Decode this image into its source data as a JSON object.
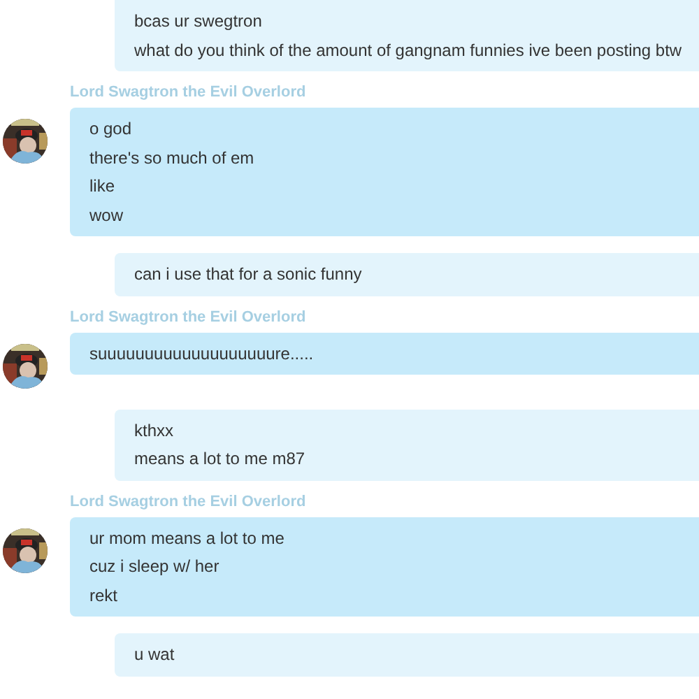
{
  "messages": [
    {
      "kind": "outgoing",
      "lines": [
        "bcas ur swegtron",
        "what do you think of the amount of gangnam funnies ive been posting btw"
      ]
    },
    {
      "kind": "incoming",
      "sender": "Lord Swagtron the Evil Overlord",
      "lines": [
        "o god",
        "there's so much of em",
        "like",
        "wow"
      ]
    },
    {
      "kind": "outgoing",
      "lines": [
        "can i use that for a sonic funny"
      ]
    },
    {
      "kind": "incoming",
      "sender": "Lord Swagtron the Evil Overlord",
      "lines": [
        "suuuuuuuuuuuuuuuuuuure....."
      ]
    },
    {
      "kind": "outgoing",
      "lines": [
        "kthxx",
        "means a lot to me m87"
      ]
    },
    {
      "kind": "incoming",
      "sender": "Lord Swagtron the Evil Overlord",
      "lines": [
        "ur mom means a lot to me",
        "cuz i sleep w/ her",
        "rekt"
      ]
    },
    {
      "kind": "outgoing",
      "lines": [
        "u wat"
      ]
    }
  ]
}
